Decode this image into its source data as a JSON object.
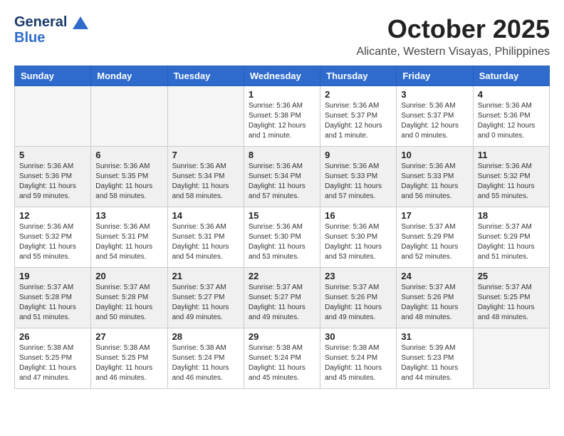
{
  "header": {
    "logo_line1": "General",
    "logo_line2": "Blue",
    "month": "October 2025",
    "location": "Alicante, Western Visayas, Philippines"
  },
  "days_of_week": [
    "Sunday",
    "Monday",
    "Tuesday",
    "Wednesday",
    "Thursday",
    "Friday",
    "Saturday"
  ],
  "weeks": [
    {
      "shaded": false,
      "days": [
        {
          "num": "",
          "info": ""
        },
        {
          "num": "",
          "info": ""
        },
        {
          "num": "",
          "info": ""
        },
        {
          "num": "1",
          "info": "Sunrise: 5:36 AM\nSunset: 5:38 PM\nDaylight: 12 hours\nand 1 minute."
        },
        {
          "num": "2",
          "info": "Sunrise: 5:36 AM\nSunset: 5:37 PM\nDaylight: 12 hours\nand 1 minute."
        },
        {
          "num": "3",
          "info": "Sunrise: 5:36 AM\nSunset: 5:37 PM\nDaylight: 12 hours\nand 0 minutes."
        },
        {
          "num": "4",
          "info": "Sunrise: 5:36 AM\nSunset: 5:36 PM\nDaylight: 12 hours\nand 0 minutes."
        }
      ]
    },
    {
      "shaded": true,
      "days": [
        {
          "num": "5",
          "info": "Sunrise: 5:36 AM\nSunset: 5:36 PM\nDaylight: 11 hours\nand 59 minutes."
        },
        {
          "num": "6",
          "info": "Sunrise: 5:36 AM\nSunset: 5:35 PM\nDaylight: 11 hours\nand 58 minutes."
        },
        {
          "num": "7",
          "info": "Sunrise: 5:36 AM\nSunset: 5:34 PM\nDaylight: 11 hours\nand 58 minutes."
        },
        {
          "num": "8",
          "info": "Sunrise: 5:36 AM\nSunset: 5:34 PM\nDaylight: 11 hours\nand 57 minutes."
        },
        {
          "num": "9",
          "info": "Sunrise: 5:36 AM\nSunset: 5:33 PM\nDaylight: 11 hours\nand 57 minutes."
        },
        {
          "num": "10",
          "info": "Sunrise: 5:36 AM\nSunset: 5:33 PM\nDaylight: 11 hours\nand 56 minutes."
        },
        {
          "num": "11",
          "info": "Sunrise: 5:36 AM\nSunset: 5:32 PM\nDaylight: 11 hours\nand 55 minutes."
        }
      ]
    },
    {
      "shaded": false,
      "days": [
        {
          "num": "12",
          "info": "Sunrise: 5:36 AM\nSunset: 5:32 PM\nDaylight: 11 hours\nand 55 minutes."
        },
        {
          "num": "13",
          "info": "Sunrise: 5:36 AM\nSunset: 5:31 PM\nDaylight: 11 hours\nand 54 minutes."
        },
        {
          "num": "14",
          "info": "Sunrise: 5:36 AM\nSunset: 5:31 PM\nDaylight: 11 hours\nand 54 minutes."
        },
        {
          "num": "15",
          "info": "Sunrise: 5:36 AM\nSunset: 5:30 PM\nDaylight: 11 hours\nand 53 minutes."
        },
        {
          "num": "16",
          "info": "Sunrise: 5:36 AM\nSunset: 5:30 PM\nDaylight: 11 hours\nand 53 minutes."
        },
        {
          "num": "17",
          "info": "Sunrise: 5:37 AM\nSunset: 5:29 PM\nDaylight: 11 hours\nand 52 minutes."
        },
        {
          "num": "18",
          "info": "Sunrise: 5:37 AM\nSunset: 5:29 PM\nDaylight: 11 hours\nand 51 minutes."
        }
      ]
    },
    {
      "shaded": true,
      "days": [
        {
          "num": "19",
          "info": "Sunrise: 5:37 AM\nSunset: 5:28 PM\nDaylight: 11 hours\nand 51 minutes."
        },
        {
          "num": "20",
          "info": "Sunrise: 5:37 AM\nSunset: 5:28 PM\nDaylight: 11 hours\nand 50 minutes."
        },
        {
          "num": "21",
          "info": "Sunrise: 5:37 AM\nSunset: 5:27 PM\nDaylight: 11 hours\nand 49 minutes."
        },
        {
          "num": "22",
          "info": "Sunrise: 5:37 AM\nSunset: 5:27 PM\nDaylight: 11 hours\nand 49 minutes."
        },
        {
          "num": "23",
          "info": "Sunrise: 5:37 AM\nSunset: 5:26 PM\nDaylight: 11 hours\nand 49 minutes."
        },
        {
          "num": "24",
          "info": "Sunrise: 5:37 AM\nSunset: 5:26 PM\nDaylight: 11 hours\nand 48 minutes."
        },
        {
          "num": "25",
          "info": "Sunrise: 5:37 AM\nSunset: 5:25 PM\nDaylight: 11 hours\nand 48 minutes."
        }
      ]
    },
    {
      "shaded": false,
      "days": [
        {
          "num": "26",
          "info": "Sunrise: 5:38 AM\nSunset: 5:25 PM\nDaylight: 11 hours\nand 47 minutes."
        },
        {
          "num": "27",
          "info": "Sunrise: 5:38 AM\nSunset: 5:25 PM\nDaylight: 11 hours\nand 46 minutes."
        },
        {
          "num": "28",
          "info": "Sunrise: 5:38 AM\nSunset: 5:24 PM\nDaylight: 11 hours\nand 46 minutes."
        },
        {
          "num": "29",
          "info": "Sunrise: 5:38 AM\nSunset: 5:24 PM\nDaylight: 11 hours\nand 45 minutes."
        },
        {
          "num": "30",
          "info": "Sunrise: 5:38 AM\nSunset: 5:24 PM\nDaylight: 11 hours\nand 45 minutes."
        },
        {
          "num": "31",
          "info": "Sunrise: 5:39 AM\nSunset: 5:23 PM\nDaylight: 11 hours\nand 44 minutes."
        },
        {
          "num": "",
          "info": ""
        }
      ]
    }
  ]
}
